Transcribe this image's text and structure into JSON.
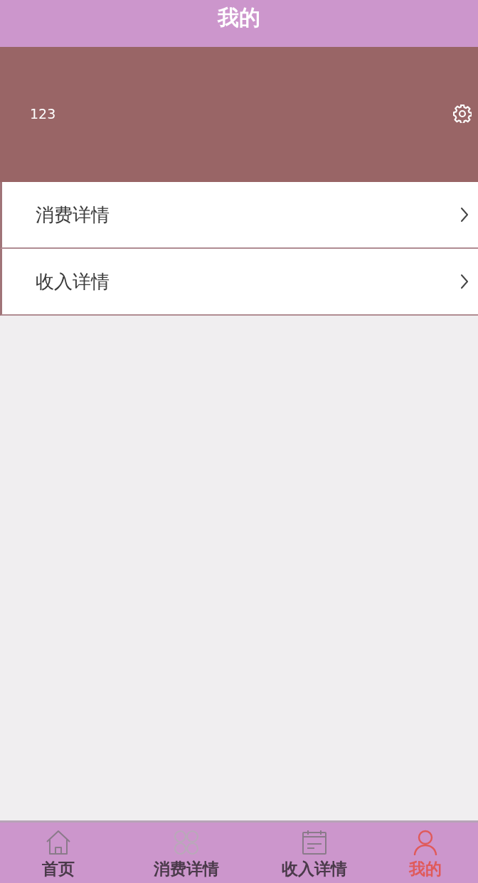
{
  "header": {
    "title": "我的"
  },
  "profile": {
    "username": "123"
  },
  "menu": [
    {
      "label": "消费详情"
    },
    {
      "label": "收入详情"
    }
  ],
  "tab_bar": [
    {
      "kind": "home",
      "label": "首页",
      "selected": false
    },
    {
      "kind": "grid",
      "label": "消费详情",
      "selected": false
    },
    {
      "kind": "calendar",
      "label": "收入详情",
      "selected": false
    },
    {
      "kind": "person",
      "label": "我的",
      "selected": true
    }
  ]
}
